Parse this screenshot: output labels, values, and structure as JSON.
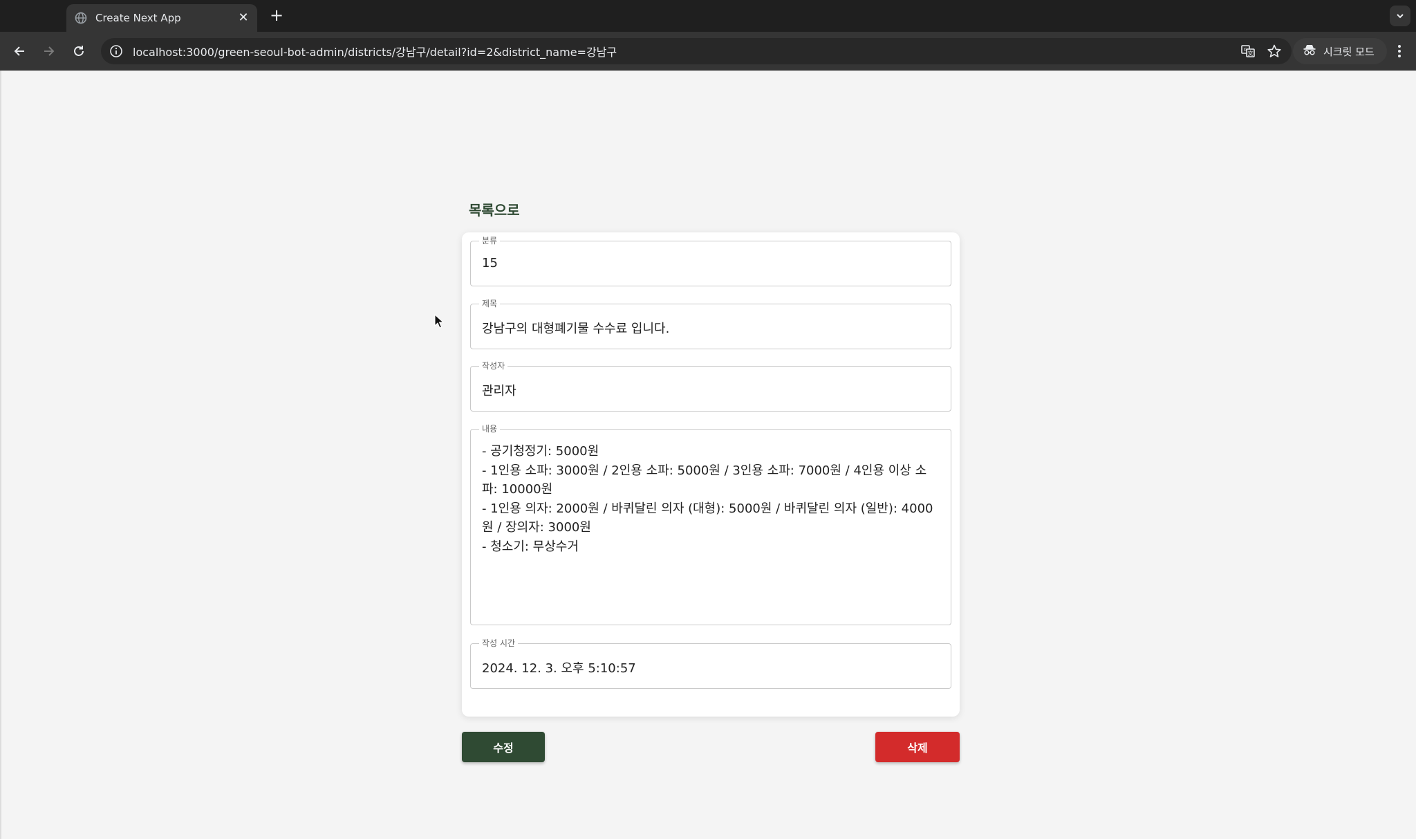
{
  "browser": {
    "tab_title": "Create Next App",
    "url": "localhost:3000/green-seoul-bot-admin/districts/강남구/detail?id=2&district_name=강남구",
    "incognito_label": "시크릿 모드"
  },
  "page": {
    "back_link": "목록으로",
    "fields": {
      "category": {
        "label": "분류",
        "value": "15"
      },
      "title": {
        "label": "제목",
        "value": "강남구의 대형폐기물 수수료 입니다."
      },
      "author": {
        "label": "작성자",
        "value": "관리자"
      },
      "content": {
        "label": "내용",
        "lines": [
          "- 공기청정기: 5000원",
          "- 1인용 소파: 3000원 / 2인용 소파: 5000원 / 3인용 소파: 7000원 / 4인용 이상 소파: 10000원",
          "- 1인용 의자: 2000원 / 바퀴달린 의자 (대형): 5000원 / 바퀴달린 의자 (일반): 4000원 / 장의자: 3000원",
          "- 청소기: 무상수거"
        ]
      },
      "created_at": {
        "label": "작성 시간",
        "value": "2024. 12. 3. 오후 5:10:57"
      }
    },
    "buttons": {
      "edit": "수정",
      "delete": "삭제"
    }
  },
  "colors": {
    "primary_green": "#2f4a33",
    "delete_red": "#d32b2b"
  },
  "icons": [
    "globe-icon",
    "close-icon",
    "plus-icon",
    "chevron-down-icon",
    "back-arrow-icon",
    "forward-arrow-icon",
    "reload-icon",
    "info-icon",
    "translate-icon",
    "star-icon",
    "incognito-icon",
    "more-vert-icon"
  ]
}
